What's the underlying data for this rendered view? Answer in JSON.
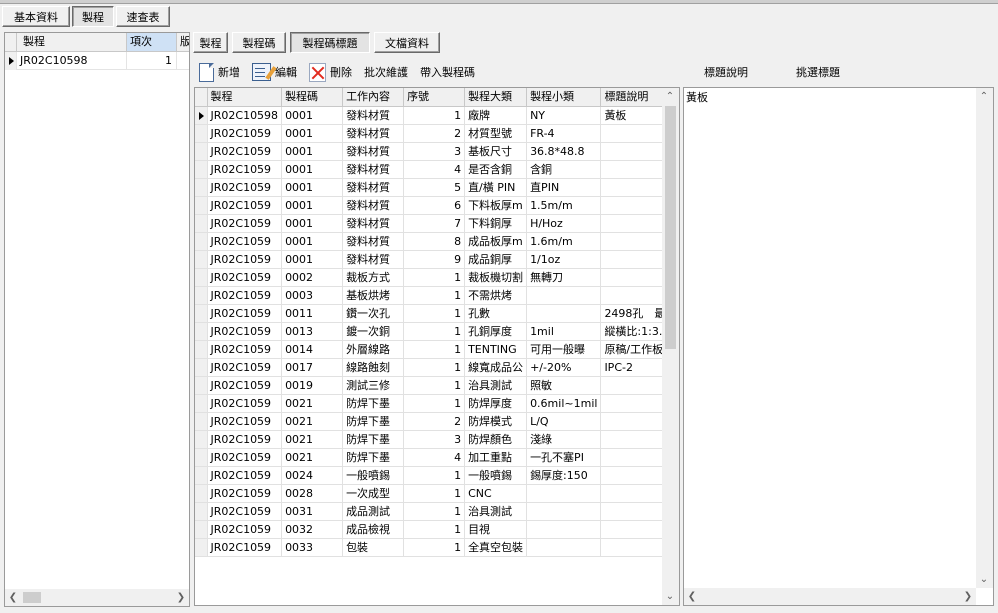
{
  "main_tabs": [
    {
      "label": "基本資料",
      "active": false
    },
    {
      "label": "製程",
      "active": true
    },
    {
      "label": "速查表",
      "active": false
    }
  ],
  "left_grid": {
    "headers": [
      "製程",
      "項次",
      "版"
    ],
    "rows": [
      {
        "process": "JR02C10598",
        "item": "1"
      }
    ]
  },
  "sub_tabs": [
    {
      "label": "製程",
      "active": false
    },
    {
      "label": "製程碼",
      "active": false
    },
    {
      "label": "製程碼標題",
      "active": true
    },
    {
      "label": "文檔資料",
      "active": false
    }
  ],
  "toolbar": {
    "new": "新增",
    "edit": "編輯",
    "delete": "刪除",
    "batch": "批次維護",
    "import": "帶入製程碼"
  },
  "right_labels": {
    "title_desc": "標題說明",
    "pick_title": "挑選標題"
  },
  "grid": {
    "headers": [
      "製程",
      "製程碼",
      "工作內容",
      "序號",
      "製程大類",
      "製程小類",
      "標題說明"
    ],
    "rows": [
      [
        "JR02C10598",
        "0001",
        "發料材質",
        "1",
        "廠牌",
        "NY",
        "黃板"
      ],
      [
        "JR02C1059",
        "0001",
        "發料材質",
        "2",
        "材質型號",
        "FR-4",
        ""
      ],
      [
        "JR02C1059",
        "0001",
        "發料材質",
        "3",
        "基板尺寸",
        "36.8*48.8",
        ""
      ],
      [
        "JR02C1059",
        "0001",
        "發料材質",
        "4",
        "是否含銅",
        "含銅",
        ""
      ],
      [
        "JR02C1059",
        "0001",
        "發料材質",
        "5",
        "直/橫 PIN",
        "直PIN",
        ""
      ],
      [
        "JR02C1059",
        "0001",
        "發料材質",
        "6",
        "下料板厚m",
        "1.5m/m",
        ""
      ],
      [
        "JR02C1059",
        "0001",
        "發料材質",
        "7",
        "下料銅厚",
        "H/Hoz",
        ""
      ],
      [
        "JR02C1059",
        "0001",
        "發料材質",
        "8",
        "成品板厚m",
        "1.6m/m",
        ""
      ],
      [
        "JR02C1059",
        "0001",
        "發料材質",
        "9",
        "成品銅厚",
        "1/1oz",
        ""
      ],
      [
        "JR02C1059",
        "0002",
        "裁板方式",
        "1",
        "裁板機切割",
        "無轉刀",
        ""
      ],
      [
        "JR02C1059",
        "0003",
        "基板烘烤",
        "1",
        "不需烘烤",
        "",
        ""
      ],
      [
        "JR02C1059",
        "0011",
        "鑽一次孔",
        "1",
        "孔數",
        "",
        "2498孔　最"
      ],
      [
        "JR02C1059",
        "0013",
        "鍍一次銅",
        "1",
        "孔銅厚度",
        "1mil",
        "縱橫比:1:3."
      ],
      [
        "JR02C1059",
        "0014",
        "外層線路",
        "1",
        "TENTING",
        "可用一般曝",
        "原稿/工作板"
      ],
      [
        "JR02C1059",
        "0017",
        "線路蝕刻",
        "1",
        "線寬成品公",
        "+/-20%",
        "IPC-2"
      ],
      [
        "JR02C1059",
        "0019",
        "測試三修",
        "1",
        "治具測試",
        "照敏",
        ""
      ],
      [
        "JR02C1059",
        "0021",
        "防焊下墨",
        "1",
        "防焊厚度",
        "0.6mil~1mil",
        ""
      ],
      [
        "JR02C1059",
        "0021",
        "防焊下墨",
        "2",
        "防焊模式",
        "L/Q",
        ""
      ],
      [
        "JR02C1059",
        "0021",
        "防焊下墨",
        "3",
        "防焊顏色",
        "淺綠",
        ""
      ],
      [
        "JR02C1059",
        "0021",
        "防焊下墨",
        "4",
        "加工重點",
        "一孔不塞PI",
        ""
      ],
      [
        "JR02C1059",
        "0024",
        "一般噴錫",
        "1",
        "一般噴錫",
        "錫厚度:150",
        ""
      ],
      [
        "JR02C1059",
        "0028",
        "一次成型",
        "1",
        "CNC",
        "",
        ""
      ],
      [
        "JR02C1059",
        "0031",
        "成品測試",
        "1",
        "治具測試",
        "",
        ""
      ],
      [
        "JR02C1059",
        "0032",
        "成品檢視",
        "1",
        "目視",
        "",
        ""
      ],
      [
        "JR02C1059",
        "0033",
        "包裝",
        "1",
        "全真空包裝",
        "",
        ""
      ]
    ]
  },
  "right_panel": {
    "text": "黃板"
  },
  "icons": {
    "new": "new-document-icon",
    "edit": "edit-document-icon",
    "delete": "delete-x-icon"
  }
}
